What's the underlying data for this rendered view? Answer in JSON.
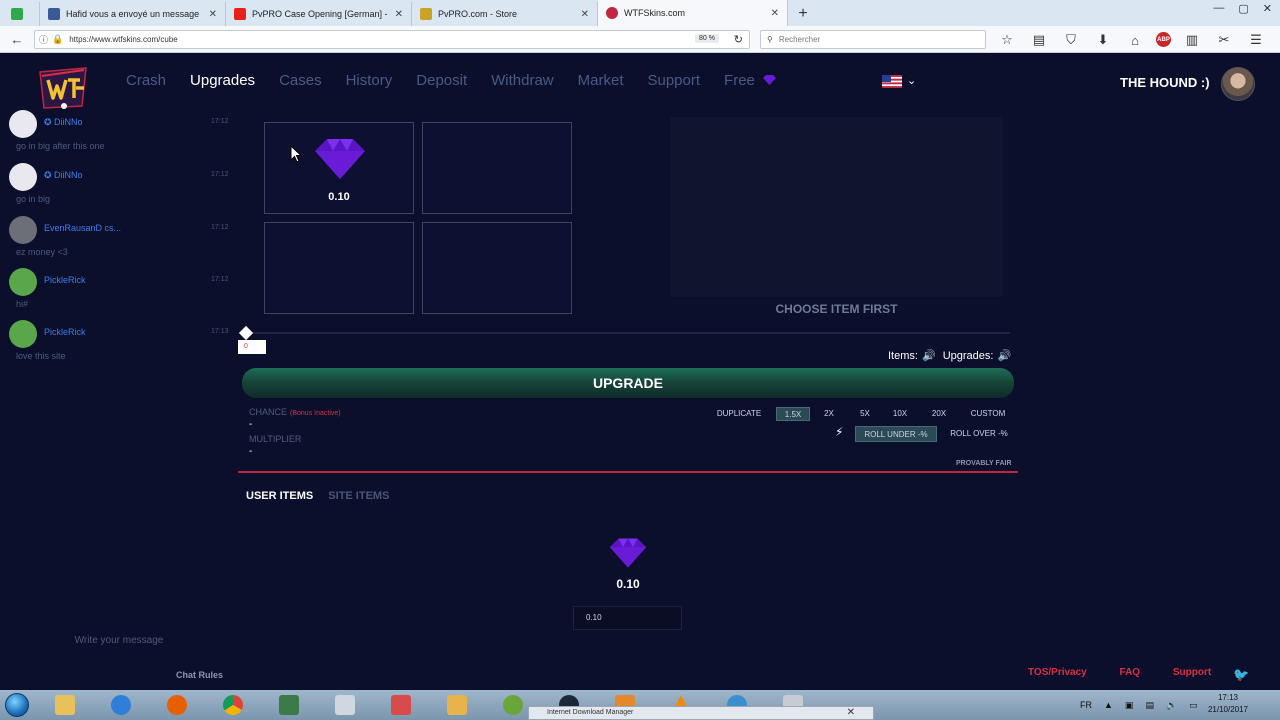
{
  "browser": {
    "tabs": [
      {
        "label": "Hafid vous a envoyé un message",
        "color": "#3b5998"
      },
      {
        "label": "PvPRO Case Opening [German] - Pl",
        "color": "#e62117"
      },
      {
        "label": "PvPRO.com - Store",
        "color": "#c9a227"
      },
      {
        "label": "WTFSkins.com",
        "color": "#c0263f"
      }
    ],
    "url": "https://www.wtfskins.com/cube",
    "zoom": "80 %",
    "search_placeholder": "Rechercher",
    "abp_label": "ABP"
  },
  "nav": {
    "items": [
      "Crash",
      "Upgrades",
      "Cases",
      "History",
      "Deposit",
      "Withdraw",
      "Market",
      "Support",
      "Free"
    ],
    "active": "Upgrades"
  },
  "user": {
    "name": "THE HOUND :)"
  },
  "chat": {
    "messages": [
      {
        "name": "✪ DiiNNo",
        "time": "17:12",
        "text": "go in big after this one",
        "avatar": "#e8e8ee"
      },
      {
        "name": "✪ DiiNNo",
        "time": "17:12",
        "text": "go in big",
        "avatar": "#e8e8ee"
      },
      {
        "name": "EvenRausanD cs...",
        "time": "17:12",
        "text": "ez money <3",
        "avatar": "#6c6f78"
      },
      {
        "name": "PickleRick",
        "time": "17:12",
        "text": "hi#",
        "avatar": "#5aa64b"
      },
      {
        "name": "PickleRick",
        "time": "17:13",
        "text": "love this site",
        "avatar": "#5aa64b"
      }
    ],
    "input_placeholder": "Write your message",
    "rules_label": "Chat Rules"
  },
  "upgrade": {
    "slot_value": "0.10",
    "choose_first": "CHOOSE ITEM FIRST",
    "slider_value": "0",
    "items_label": "Items:",
    "upgrades_label": "Upgrades:",
    "button_label": "UPGRADE",
    "chance_label": "CHANCE",
    "bonus_label": "(Bonus Inactive)",
    "chance_value": "-",
    "multiplier_label": "MULTIPLIER",
    "multiplier_value": "-",
    "multipliers": [
      "DUPLICATE",
      "1.5X",
      "2X",
      "5X",
      "10X",
      "20X",
      "CUSTOM"
    ],
    "multiplier_active": "1.5X",
    "roll_under": "ROLL UNDER -%",
    "roll_over": "ROLL OVER -%",
    "provably_fair": "PROVABLY FAIR"
  },
  "items": {
    "tabs": [
      "USER ITEMS",
      "SITE ITEMS"
    ],
    "active_tab": "USER ITEMS",
    "user_item_value": "0.10",
    "amount_value": "0.10"
  },
  "footer": {
    "links": [
      "TOS/Privacy",
      "FAQ",
      "Support"
    ]
  },
  "taskbar": {
    "tooltip": "Internet Download Manager",
    "lang": "FR",
    "time": "17:13",
    "date": "21/10/2017"
  },
  "colors": {
    "background": "#0c0f2b",
    "gem": "#6a1bd8",
    "accent_red": "#d73147",
    "upgrade_green": "#1f6e58"
  }
}
